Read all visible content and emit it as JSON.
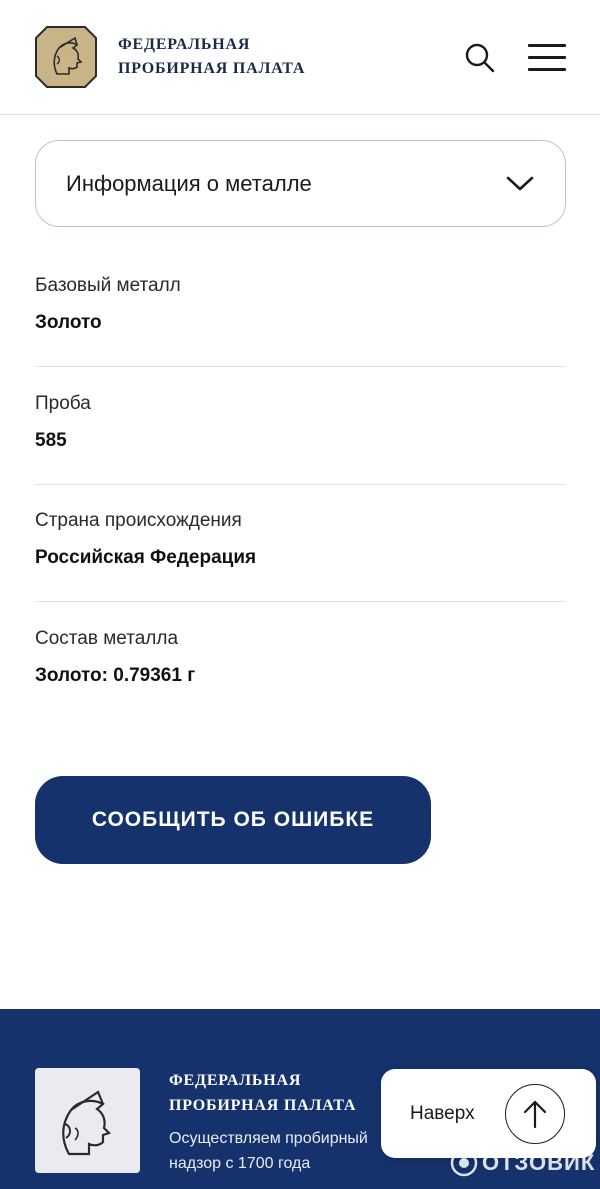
{
  "header": {
    "brand_line1": "ФЕДЕРАЛЬНАЯ",
    "brand_line2": "ПРОБИРНАЯ ПАЛАТА",
    "logo_icon": "assay-chamber-logo-icon",
    "search_icon": "search-icon",
    "menu_icon": "hamburger-menu-icon"
  },
  "accordion": {
    "label": "Информация о металле",
    "icon": "chevron-down-icon"
  },
  "info": [
    {
      "label": "Базовый металл",
      "value": "Золото"
    },
    {
      "label": "Проба",
      "value": "585"
    },
    {
      "label": "Страна происхождения",
      "value": "Российская Федерация"
    },
    {
      "label": "Состав металла",
      "value": "Золото: 0.79361 г"
    }
  ],
  "report_button": {
    "label": "СООБЩИТЬ ОБ ОШИБКЕ"
  },
  "footer": {
    "brand_line1": "ФЕДЕРАЛЬНАЯ",
    "brand_line2": "ПРОБИРНАЯ ПАЛАТА",
    "desc_line1": "Осуществляем пробирный",
    "desc_line2": "надзор с 1700 года"
  },
  "to_top": {
    "label": "Наверх",
    "icon": "arrow-up-icon"
  },
  "watermark": {
    "text": "ОТЗОВИК"
  },
  "colors": {
    "primary": "#16326c",
    "border": "#b9c4d3",
    "logo_gold": "#c9b487",
    "divider": "#e3e3e3"
  }
}
